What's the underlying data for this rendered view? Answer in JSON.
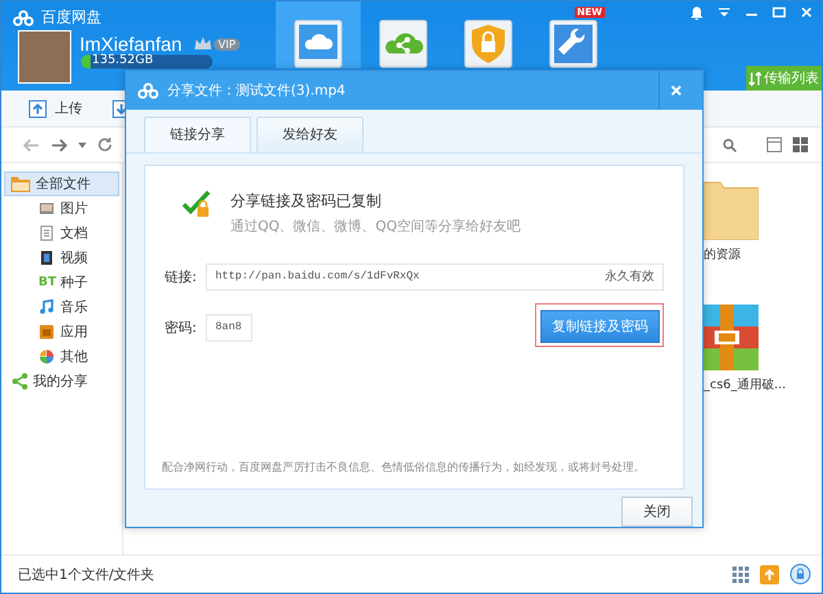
{
  "app": {
    "title": "百度网盘"
  },
  "user": {
    "name": "ImXiefanfan",
    "vip": "VIP",
    "storage": "135.52GB"
  },
  "nav_tiles": [
    {
      "selected": true
    },
    {
      "selected": false
    },
    {
      "selected": false
    },
    {
      "selected": false,
      "badge": "NEW"
    }
  ],
  "transfer_button": "传输列表",
  "toolbar": {
    "upload": "上传"
  },
  "sidebar": {
    "items": [
      {
        "label": "全部文件",
        "selected": true,
        "children": [
          {
            "label": "图片",
            "selected": false
          },
          {
            "label": "文档",
            "selected": false
          },
          {
            "label": "视频",
            "selected": false
          },
          {
            "label": "种子",
            "selected": false,
            "badge": "BT"
          },
          {
            "label": "音乐",
            "selected": false
          },
          {
            "label": "应用",
            "selected": false
          },
          {
            "label": "其他",
            "selected": false
          }
        ]
      },
      {
        "label": "我的分享",
        "selected": false
      }
    ]
  },
  "files": [
    {
      "name": "的资源",
      "kind": "folder"
    },
    {
      "name": "_cs6_通用破...",
      "kind": "archive"
    }
  ],
  "status_bar": "已选中1个文件/文件夹",
  "dialog": {
    "title": "分享文件：测试文件(3).mp4",
    "tabs": [
      {
        "label": "链接分享",
        "selected": true
      },
      {
        "label": "发给好友",
        "selected": false
      }
    ],
    "headline": "分享链接及密码已复制",
    "subline": "通过QQ、微信、微博、QQ空间等分享给好友吧",
    "link_label": "链接:",
    "link": "http://pan.baidu.com/s/1dFvRxQx",
    "validity": "永久有效",
    "password_label": "密码:",
    "password": "8an8",
    "copy_button": {
      "label": "复制链接及密码",
      "highlighted": true
    },
    "notice": "配合净网行动，百度网盘严厉打击不良信息、色情低俗信息的传播行为，如经发现，或将封号处理。",
    "close_button": "关闭"
  }
}
